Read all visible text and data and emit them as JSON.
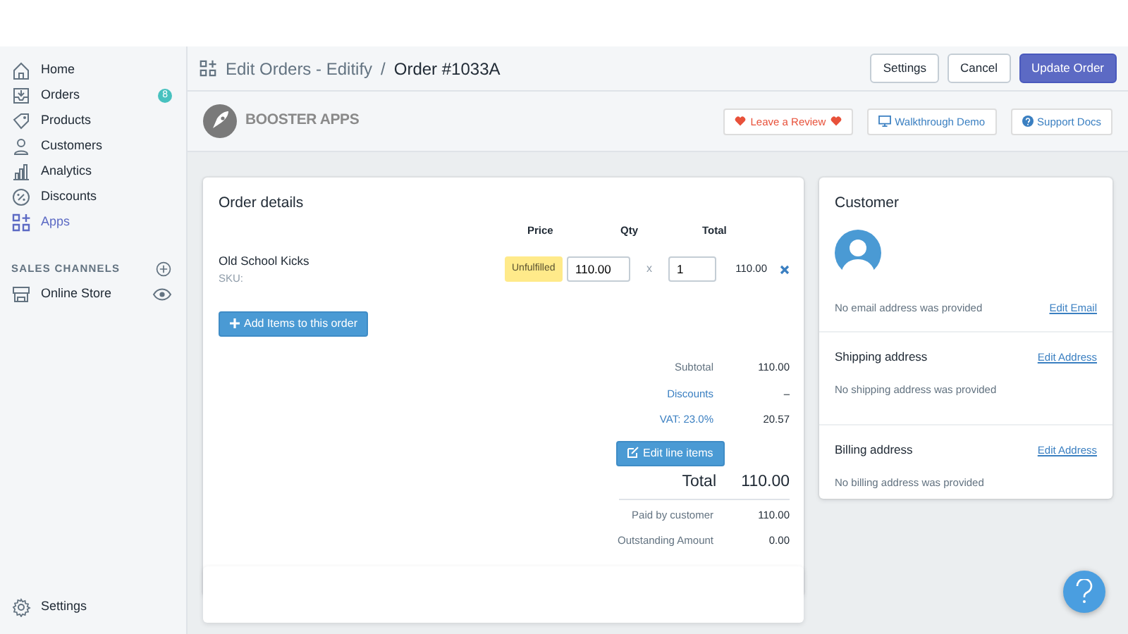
{
  "sidebar": {
    "items": [
      {
        "label": "Home",
        "kind": "home",
        "selected": false
      },
      {
        "label": "Orders",
        "kind": "orders",
        "selected": false,
        "badge": "8"
      },
      {
        "label": "Products",
        "kind": "products",
        "selected": false
      },
      {
        "label": "Customers",
        "kind": "customers",
        "selected": false
      },
      {
        "label": "Analytics",
        "kind": "analytics",
        "selected": false
      },
      {
        "label": "Discounts",
        "kind": "discounts",
        "selected": false
      },
      {
        "label": "Apps",
        "kind": "apps",
        "selected": true
      }
    ],
    "sales_channels": {
      "title": "SALES CHANNELS",
      "items": [
        {
          "label": "Online Store",
          "kind": "store"
        }
      ]
    },
    "settings": "Settings"
  },
  "header": {
    "app": "Edit Orders - Editify",
    "separator": "/",
    "title": "Order #1033A",
    "buttons": [
      {
        "label": "Settings",
        "kind": "default"
      },
      {
        "label": "Cancel",
        "kind": "default"
      },
      {
        "label": "Update Order",
        "kind": "primary"
      }
    ]
  },
  "app_bar": {
    "logo": "BOOSTER APPS",
    "links": [
      {
        "label": "Leave a Review",
        "kind": "review"
      },
      {
        "label": "Walkthrough Demo",
        "kind": "demo"
      },
      {
        "label": "Support Docs",
        "kind": "docs"
      }
    ]
  },
  "order": {
    "title": "Order details",
    "columns": [
      "Price",
      "Qty",
      "Total"
    ],
    "items": [
      {
        "name": "Old School Kicks",
        "sku": "SKU:",
        "status": "Unfulfilled",
        "price": "110.00",
        "times": "x",
        "qty": "1",
        "total": "110.00"
      }
    ],
    "add_button": "Add Items to this order",
    "summary": [
      {
        "label": "Subtotal",
        "value": "110.00",
        "kind": "plain"
      },
      {
        "label": "Discounts",
        "value": "–",
        "kind": "link"
      },
      {
        "label": "VAT: 23.0%",
        "value": "20.57",
        "kind": "link"
      }
    ],
    "edit_button": "Edit line items",
    "total": {
      "label": "Total",
      "value": "110.00"
    },
    "payments": [
      {
        "label": "Paid by customer",
        "value": "110.00"
      },
      {
        "label": "Outstanding Amount",
        "value": "0.00"
      }
    ]
  },
  "customer": {
    "title": "Customer",
    "email_note": "No email address was provided",
    "email_link": "Edit Email",
    "sections": [
      {
        "title": "Shipping address",
        "link": "Edit Address",
        "note": "No shipping address was provided"
      },
      {
        "title": "Billing address",
        "link": "Edit Address",
        "note": "No billing address was provided"
      }
    ]
  }
}
